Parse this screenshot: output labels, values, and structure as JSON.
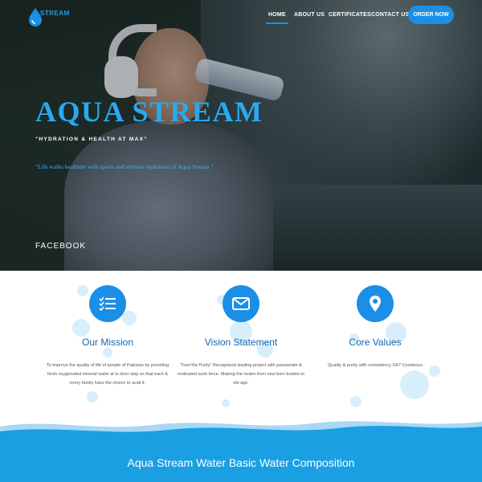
{
  "brand": {
    "logo_text": "STREAM",
    "accent": "#1b8fe6"
  },
  "nav": {
    "items": [
      {
        "label": "HOME"
      },
      {
        "label": "ABOUT US"
      },
      {
        "label": "CERTIFICATES"
      },
      {
        "label": "CONTACT US"
      }
    ],
    "order_label": "ORDER NOW"
  },
  "hero": {
    "title": "AQUA STREAM",
    "subtitle": "\"HYDRATION & HEALTH AT MAX\"",
    "quote": "\"Life walks healthier with sports and extreme hydration of Aqua Stream \"",
    "facebook": "FACEBOOK"
  },
  "features": [
    {
      "icon": "checklist-icon",
      "title": "Our Mission",
      "text": "To improve the quality of life of people of Pakistan by providing fresh oxygenated mineral water at to door step so that each & every family have the choice to avail it."
    },
    {
      "icon": "envelope-icon",
      "title": "Vision Statement",
      "text": "\"Feel the Purity\" Recognized leading project with passionate & motivated work force. Making the nudes from new born bodies to old age."
    },
    {
      "icon": "map-marker-icon",
      "title": "Core Values",
      "text": "Quality & purity with consistency 24/7 Courteous"
    }
  ],
  "composition": {
    "title": "Aqua Stream Water Basic Water Composition"
  }
}
